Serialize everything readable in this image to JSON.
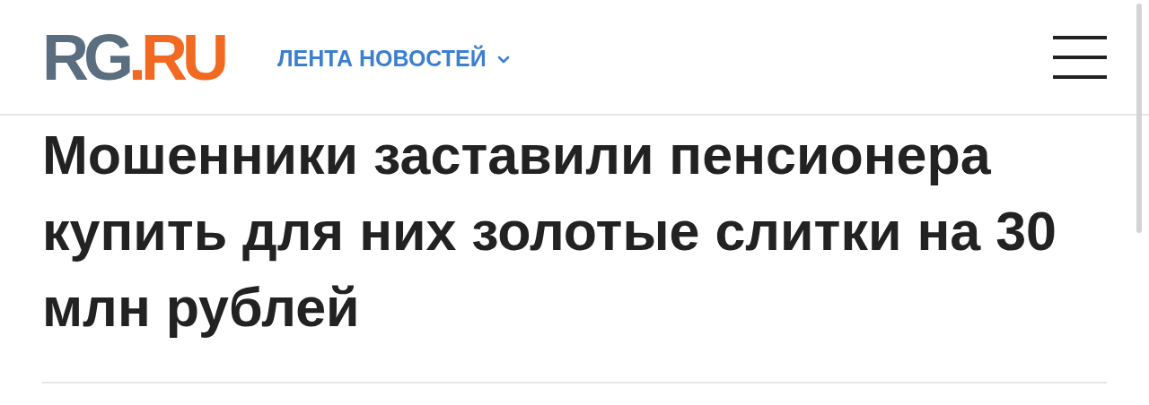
{
  "header": {
    "logo": [
      {
        "text": "RG",
        "color": "#5b6e80"
      },
      {
        "text": ".RU",
        "color": "#f26a21"
      }
    ],
    "nav": {
      "label": "ЛЕНТА НОВОСТЕЙ",
      "expanded": false
    }
  },
  "article": {
    "title": "Мошенники заставили пенсионера купить для них золотые слитки на 30 млн рублей"
  }
}
